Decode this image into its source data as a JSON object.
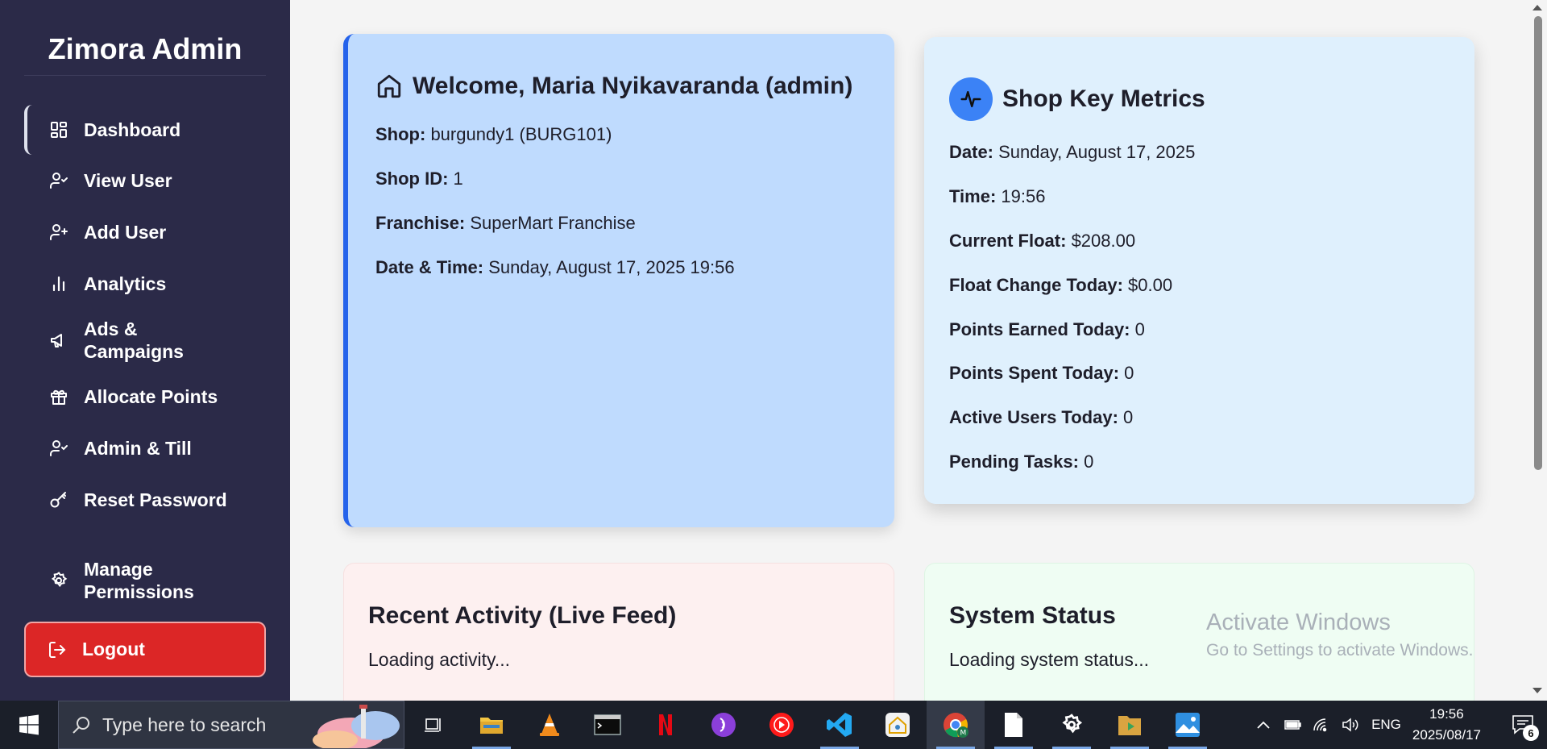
{
  "sidebar": {
    "brand": "Zimora Admin",
    "items": [
      {
        "label": "Dashboard",
        "icon": "dashboard-grid-icon"
      },
      {
        "label": "View User",
        "icon": "user-check-icon"
      },
      {
        "label": "Add User",
        "icon": "user-plus-icon"
      },
      {
        "label": "Analytics",
        "icon": "bar-chart-icon"
      },
      {
        "label": "Ads &\nCampaigns",
        "icon": "megaphone-icon"
      },
      {
        "label": "Allocate Points",
        "icon": "gift-icon"
      },
      {
        "label": "Admin & Till",
        "icon": "user-check-icon"
      },
      {
        "label": "Reset Password",
        "icon": "key-icon"
      },
      {
        "label": "Manage\nPermissions",
        "icon": "gear-icon"
      }
    ],
    "logout": "Logout"
  },
  "welcome": {
    "title": "Welcome, Maria Nyikavaranda (admin)",
    "shop_label": "Shop:",
    "shop_value": " burgundy1 (BURG101)",
    "shop_id_label": "Shop ID:",
    "shop_id_value": " 1",
    "franchise_label": "Franchise:",
    "franchise_value": " SuperMart Franchise",
    "datetime_label": "Date & Time:",
    "datetime_value": " Sunday, August 17, 2025 19:56"
  },
  "metrics": {
    "title": "Shop Key Metrics",
    "rows": [
      {
        "label": "Date:",
        "value": " Sunday, August 17, 2025"
      },
      {
        "label": "Time:",
        "value": " 19:56"
      },
      {
        "label": "Current Float:",
        "value": " $208.00"
      },
      {
        "label": "Float Change Today:",
        "value": " $0.00"
      },
      {
        "label": "Points Earned Today:",
        "value": " 0"
      },
      {
        "label": "Points Spent Today:",
        "value": " 0"
      },
      {
        "label": "Active Users Today:",
        "value": " 0"
      },
      {
        "label": "Pending Tasks:",
        "value": " 0"
      }
    ]
  },
  "activity": {
    "title": "Recent Activity (Live Feed)",
    "body": "Loading activity..."
  },
  "system_status": {
    "title": "System Status",
    "body": "Loading system status..."
  },
  "watermark": {
    "line1": "Activate Windows",
    "line2": "Go to Settings to activate Windows."
  },
  "taskbar": {
    "search_placeholder": "Type here to search",
    "lang": "ENG",
    "time": "19:56",
    "date": "2025/08/17",
    "notification_count": "6"
  }
}
